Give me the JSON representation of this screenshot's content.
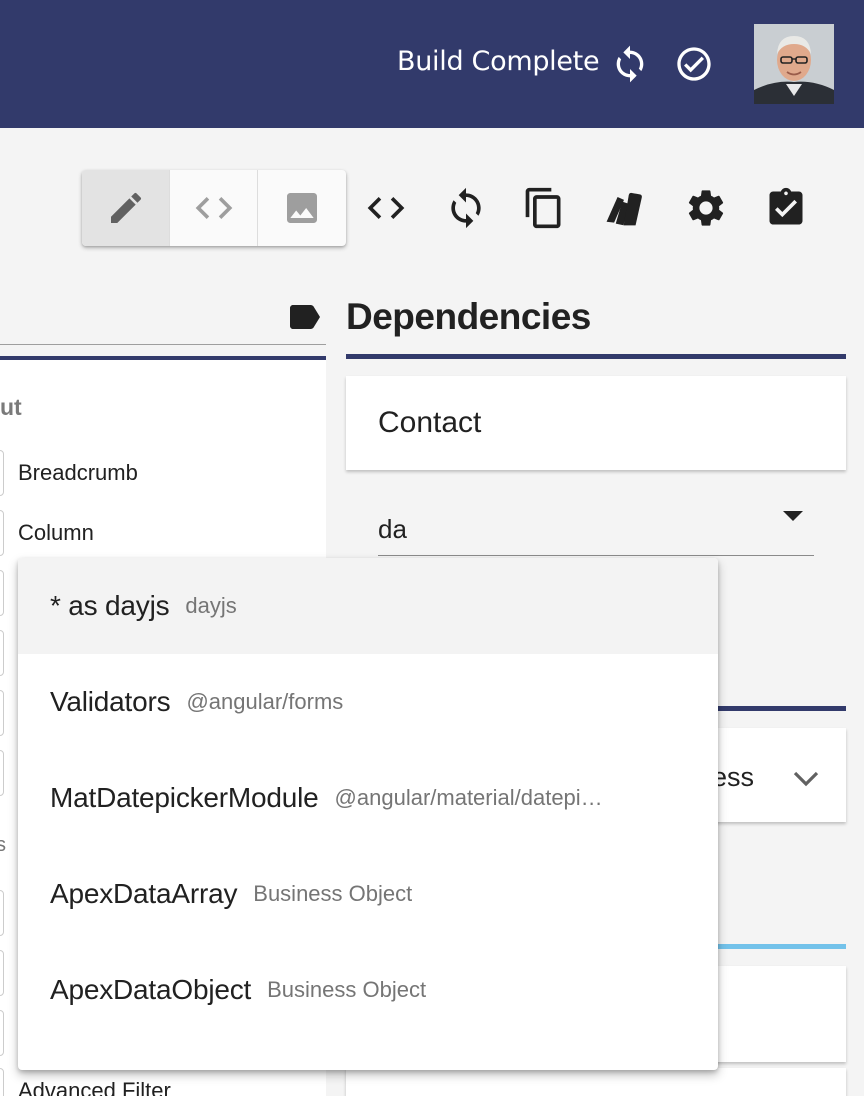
{
  "header": {
    "build_status": "Build Complete",
    "sync_icon": "sync-icon",
    "check_icon": "check-circle-icon",
    "avatar": "user-avatar"
  },
  "toolbar": {
    "view_modes": [
      {
        "icon": "pencil-icon",
        "active": true
      },
      {
        "icon": "code-icon",
        "active": false
      },
      {
        "icon": "image-icon",
        "active": false
      }
    ],
    "tools": [
      "code-icon",
      "sync-icon",
      "copy-icon",
      "swatch-icon",
      "gear-icon",
      "clipboard-check-icon"
    ]
  },
  "left_panel": {
    "tag_icon": "label-icon",
    "section_label": "ut",
    "items": [
      "Breadcrumb",
      "Column",
      "Advanced Filter"
    ],
    "partial_label": "s"
  },
  "dependencies": {
    "title": "Dependencies",
    "card_title": "Contact",
    "input_value": "da",
    "second_card_text": "ess"
  },
  "autocomplete": {
    "options": [
      {
        "name": "* as dayjs",
        "source": "dayjs"
      },
      {
        "name": "Validators",
        "source": "@angular/forms"
      },
      {
        "name": "MatDatepickerModule",
        "source": "@angular/material/datepi…"
      },
      {
        "name": "ApexDataArray",
        "source": "Business Object"
      },
      {
        "name": "ApexDataObject",
        "source": "Business Object"
      }
    ]
  },
  "colors": {
    "header_bg": "#323a6b",
    "accent_navy": "#323a6b",
    "accent_blue": "#73c2ea"
  }
}
